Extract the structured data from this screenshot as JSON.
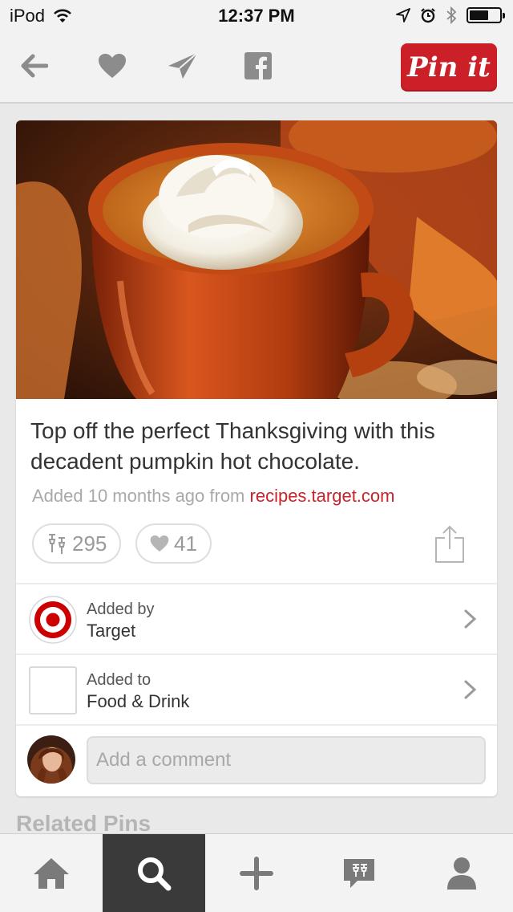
{
  "status_bar": {
    "device": "iPod",
    "time": "12:37 PM",
    "battery_level": 0.65
  },
  "toolbar": {
    "back_icon": "arrow-left-icon",
    "like_icon": "heart-icon",
    "send_icon": "paper-plane-icon",
    "facebook_icon": "facebook-icon",
    "pin_it_label": "Pin it",
    "accent_color": "#cb2027"
  },
  "pin": {
    "description": "Top off the perfect Thanksgiving with this decadent pumpkin hot chocolate.",
    "source_prefix": "Added 10 months ago from",
    "source_link": "recipes.target.com",
    "repin_count": "295",
    "like_count": "41",
    "added_by_label": "Added by",
    "added_by_name": "Target",
    "added_to_label": "Added to",
    "board_name": "Food & Drink",
    "comment_placeholder": "Add a comment"
  },
  "related_heading": "Related Pins",
  "tabbar": {
    "tabs": [
      "home-icon",
      "search-icon",
      "plus-icon",
      "notifications-icon",
      "profile-icon"
    ],
    "active_index": 1
  }
}
